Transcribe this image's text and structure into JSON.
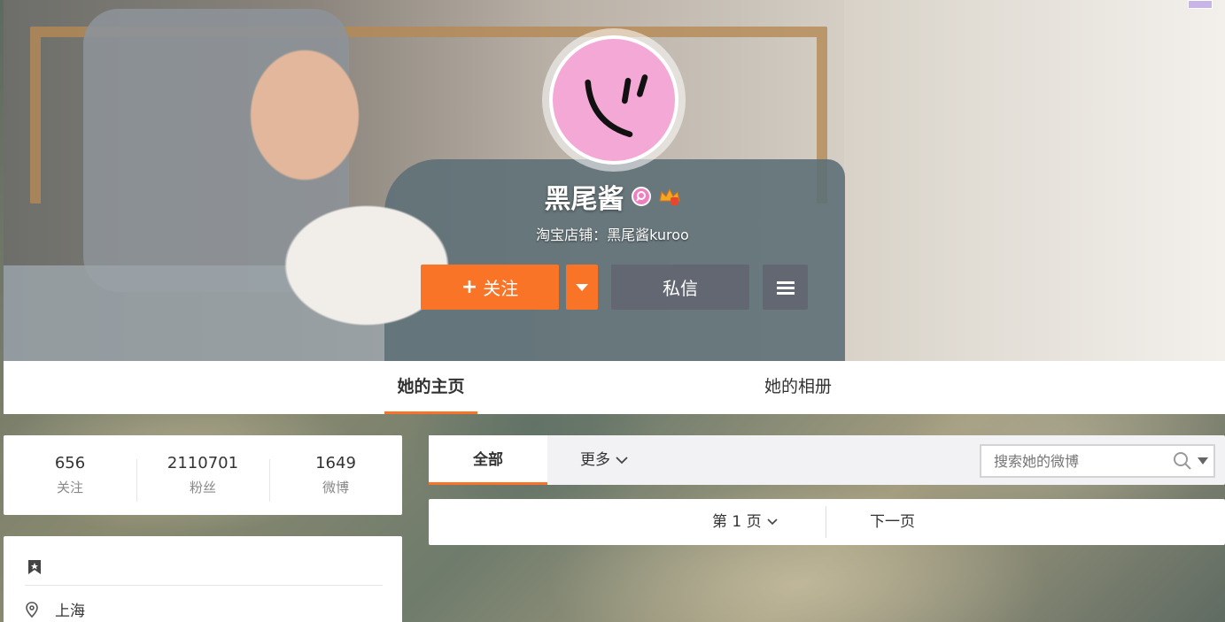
{
  "profile": {
    "name": "黑尾酱",
    "shop": "淘宝店铺：黑尾酱kuroo",
    "avatar": "pink-smiley-avatar"
  },
  "actions": {
    "follow_label": "关注",
    "message_label": "私信"
  },
  "tabs": [
    {
      "label": "她的主页",
      "active": true
    },
    {
      "label": "她的相册",
      "active": false
    }
  ],
  "stats": [
    {
      "value": "656",
      "label": "关注"
    },
    {
      "value": "2110701",
      "label": "粉丝"
    },
    {
      "value": "1649",
      "label": "微博"
    }
  ],
  "info": {
    "location": "上海"
  },
  "feed": {
    "tab_all": "全部",
    "tab_more": "更多",
    "search_placeholder": "搜索她的微博"
  },
  "pager": {
    "current": "第 1 页",
    "next": "下一页"
  },
  "colors": {
    "accent": "#f97427",
    "secondary_button": "#636772",
    "avatar_bg": "#f4a8d6"
  },
  "icons": [
    "plus-icon",
    "caret-down-icon",
    "menu-icon",
    "verified-badge-icon",
    "crown-badge-icon",
    "bookmark-icon",
    "location-icon",
    "search-icon",
    "chevron-down-icon"
  ]
}
